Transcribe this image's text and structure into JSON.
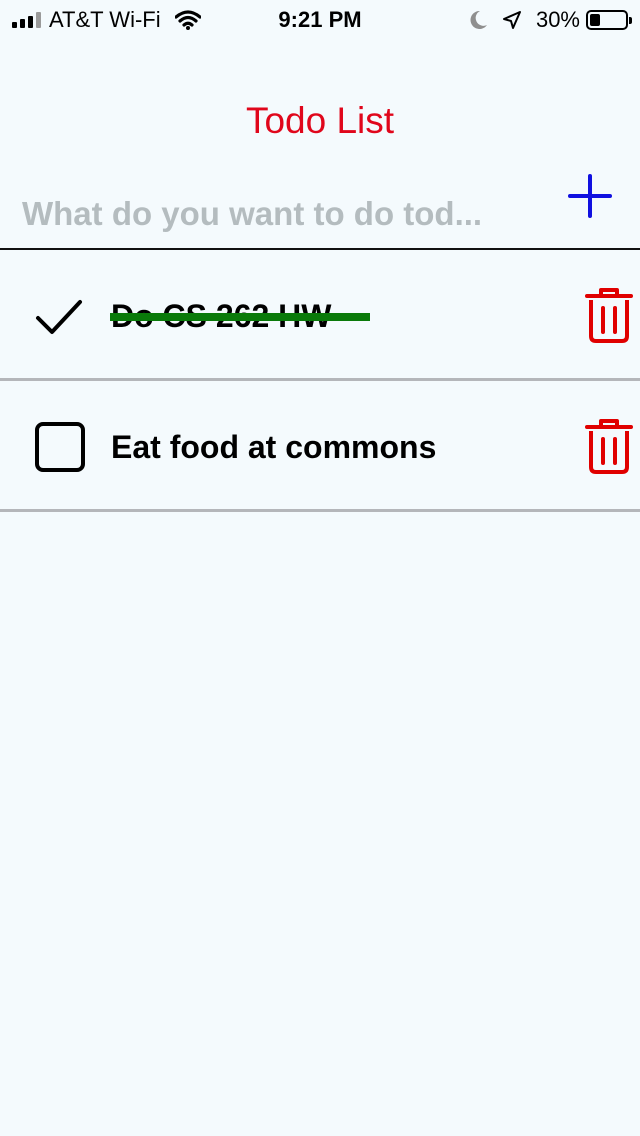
{
  "status_bar": {
    "carrier": "AT&T Wi-Fi",
    "time": "9:21 PM",
    "battery_percent": "30%",
    "battery_level": 0.3,
    "icons": [
      "signal-icon",
      "wifi-icon",
      "moon-icon",
      "location-icon",
      "battery-icon"
    ]
  },
  "header": {
    "title": "Todo List",
    "title_color": "#e0061b"
  },
  "new_todo": {
    "placeholder": "What do you want to do tod...",
    "value": "",
    "add_icon": "plus-icon",
    "add_color": "#1010e0"
  },
  "todos": [
    {
      "text": "Do CS 262 HW",
      "done": true,
      "check_icon": "checkmark-icon",
      "strike_color": "#0a7a0a",
      "delete_icon": "trash-icon"
    },
    {
      "text": "Eat food at commons",
      "done": false,
      "check_icon": "checkbox-empty-icon",
      "delete_icon": "trash-icon"
    }
  ],
  "colors": {
    "background": "#f4fafd",
    "delete": "#e00000",
    "placeholder": "#b4bcbf",
    "divider": "#b4b6ba"
  }
}
